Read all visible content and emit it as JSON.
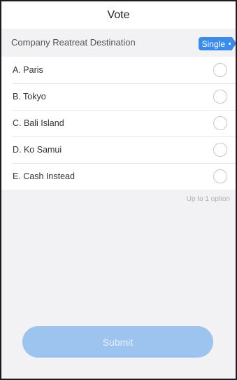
{
  "header": {
    "title": "Vote"
  },
  "poll": {
    "question": "Company Reatreat Destination",
    "type_badge": "Single",
    "options": [
      {
        "label": "A. Paris",
        "selected": false
      },
      {
        "label": "B. Tokyo",
        "selected": false
      },
      {
        "label": "C. Bali Island",
        "selected": false
      },
      {
        "label": "D. Ko Samui",
        "selected": false
      },
      {
        "label": "E. Cash Instead",
        "selected": false
      }
    ],
    "limit_hint": "Up to 1 option"
  },
  "actions": {
    "submit_label": "Submit"
  },
  "colors": {
    "accent": "#3b8be8",
    "submit_disabled": "#9cc4ee",
    "background": "#f2f2f4"
  }
}
